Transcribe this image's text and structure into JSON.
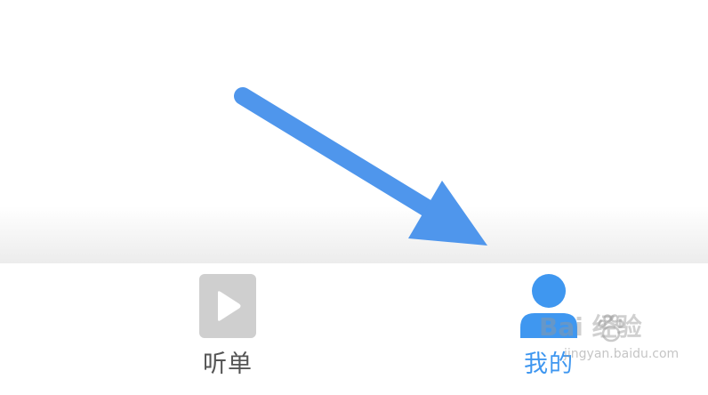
{
  "tab_bar": {
    "tabs": [
      {
        "label": "听单",
        "icon": "play-icon",
        "active": false
      },
      {
        "label": "我的",
        "icon": "user-icon",
        "active": true
      }
    ]
  },
  "watermark": {
    "logo_text": "Bai  经验",
    "url": "jingyan.baidu.com"
  },
  "colors": {
    "accent": "#3f97f0",
    "arrow": "#4f96ec",
    "inactive_icon": "#cfcfcf",
    "inactive_text": "#555555"
  }
}
